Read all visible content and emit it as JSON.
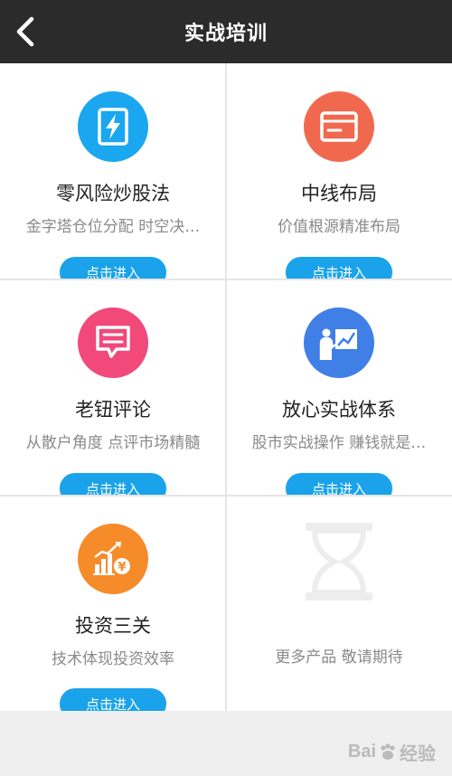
{
  "header": {
    "title": "实战培训"
  },
  "items": [
    {
      "title": "零风险炒股法",
      "subtitle": "金字塔仓位分配 时空决…",
      "button": "点击进入",
      "color": "#1aa7ef",
      "icon": "lightning-card-icon"
    },
    {
      "title": "中线布局",
      "subtitle": "价值根源精准布局",
      "button": "点击进入",
      "color": "#f0694f",
      "icon": "credit-card-icon"
    },
    {
      "title": "老钮评论",
      "subtitle": "从散户角度 点评市场精髓",
      "button": "点击进入",
      "color": "#f0497a",
      "icon": "comment-icon"
    },
    {
      "title": "放心实战体系",
      "subtitle": "股市实战操作 赚钱就是…",
      "button": "点击进入",
      "color": "#3f7fe6",
      "icon": "presentation-icon"
    },
    {
      "title": "投资三关",
      "subtitle": "技术体现投资效率",
      "button": "点击进入",
      "color": "#f68b2a",
      "icon": "growth-chart-icon"
    },
    {
      "title": "",
      "subtitle": "更多产品 敬请期待",
      "button": "",
      "color": "#eeeeee",
      "icon": "hourglass-icon"
    }
  ],
  "watermark": {
    "brand_left": "Bai",
    "brand_right": "经验"
  }
}
